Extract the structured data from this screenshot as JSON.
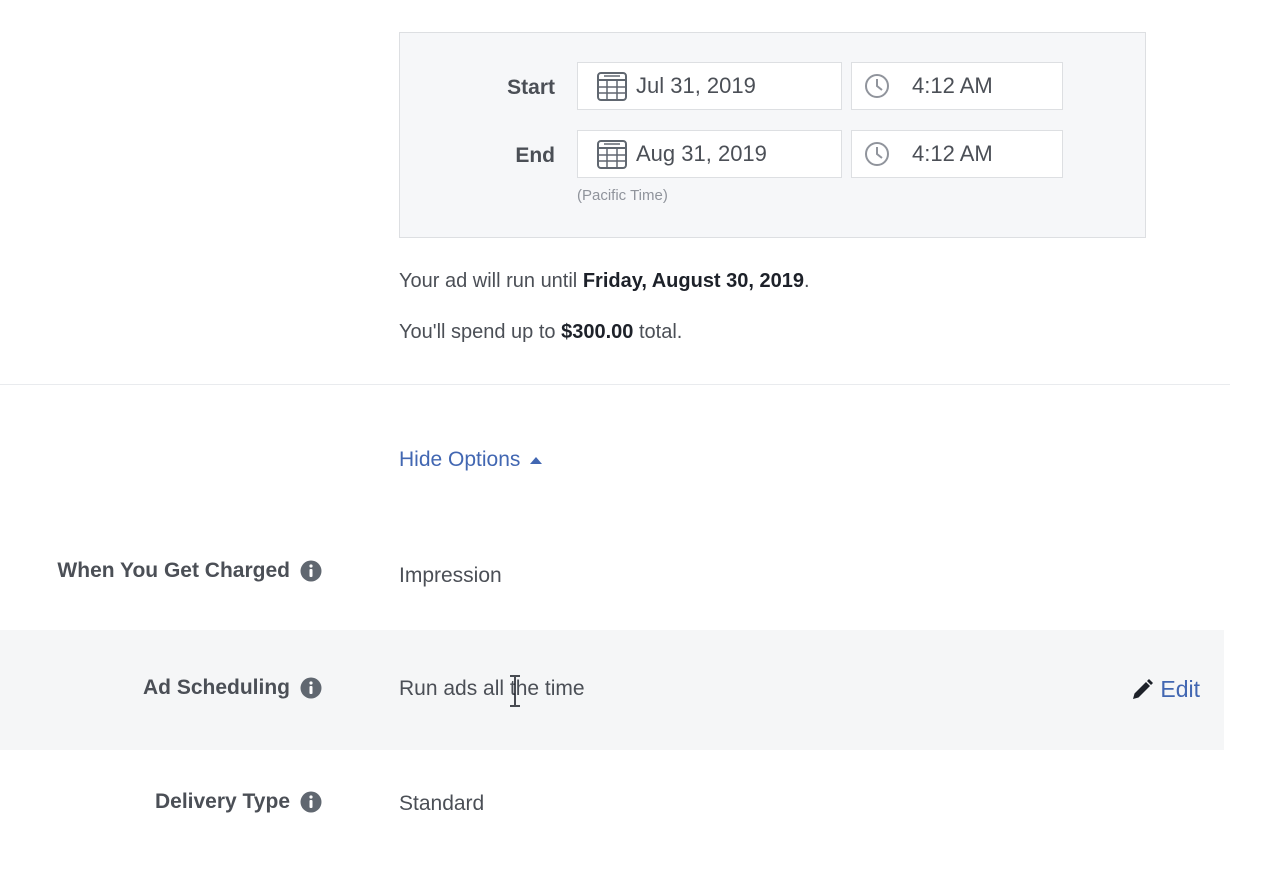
{
  "schedule": {
    "start_label": "Start",
    "end_label": "End",
    "start_date": "Jul 31, 2019",
    "start_time": "4:12 AM",
    "end_date": "Aug 31, 2019",
    "end_time": "4:12 AM",
    "timezone_note": "(Pacific Time)",
    "date_icon": "calendar-icon",
    "time_icon": "clock-icon"
  },
  "summary": {
    "run_until_prefix": "Your ad will run until ",
    "run_until_date": "Friday, August 30, 2019",
    "run_until_suffix": ".",
    "spend_prefix": "You'll spend up to ",
    "spend_amount": "$300.00",
    "spend_suffix": " total."
  },
  "options": {
    "toggle_label": "Hide Options",
    "toggle_icon": "caret-up-icon"
  },
  "settings": [
    {
      "label": "When You Get Charged",
      "value": "Impression"
    },
    {
      "label": "Ad Scheduling",
      "value": "Run ads all the time",
      "action": "Edit",
      "action_icon": "pencil-icon"
    },
    {
      "label": "Delivery Type",
      "value": "Standard"
    }
  ],
  "colors": {
    "link": "#4267b2",
    "text": "#4b4f56",
    "highlight_row": "#f5f6f7",
    "box_bg": "#f6f7f9"
  }
}
